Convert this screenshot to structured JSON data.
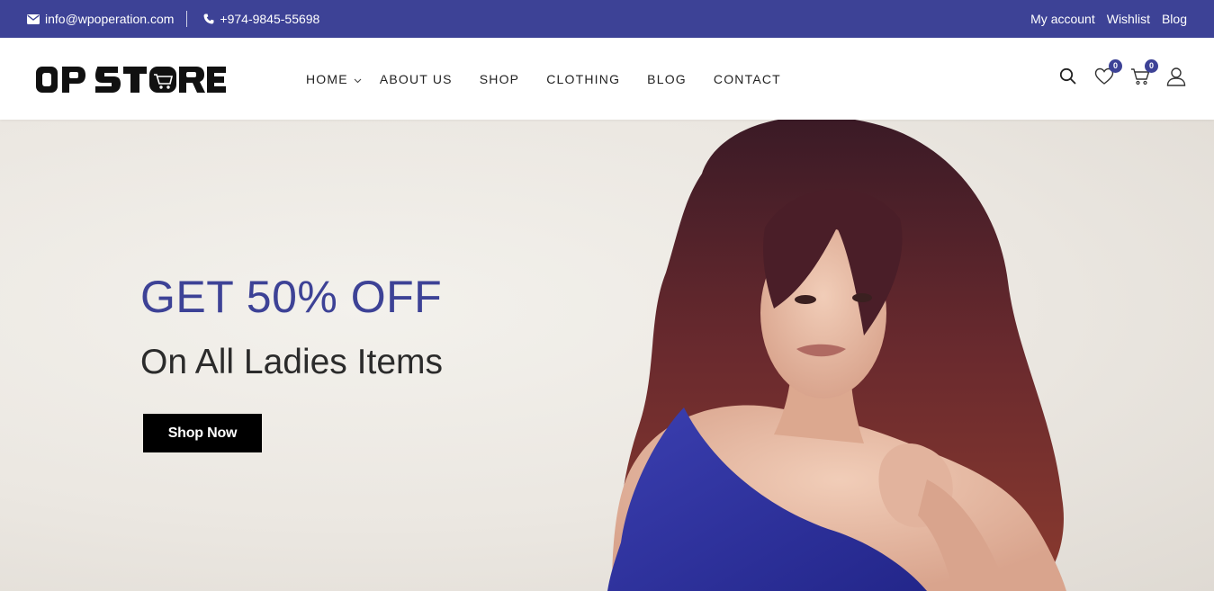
{
  "topbar": {
    "email": "info@wpoperation.com",
    "phone": "+974-9845-55698",
    "links": [
      "My account",
      "Wishlist",
      "Blog"
    ],
    "email_icon": "envelope-icon",
    "phone_icon": "phone-icon"
  },
  "header": {
    "logo_text": "OP STORE",
    "nav": [
      "HOME",
      "ABOUT US",
      "SHOP",
      "CLOTHING",
      "BLOG",
      "CONTACT"
    ],
    "wishlist_count": "0",
    "cart_count": "0",
    "icons": [
      "search-icon",
      "heart-icon",
      "cart-icon",
      "user-icon"
    ]
  },
  "hero": {
    "headline": "GET 50% OFF",
    "subheadline": "On All Ladies Items",
    "cta": "Shop Now"
  },
  "colors": {
    "brand": "#3d4296",
    "cta_bg": "#000000",
    "text_dark": "#2b2b2b"
  }
}
